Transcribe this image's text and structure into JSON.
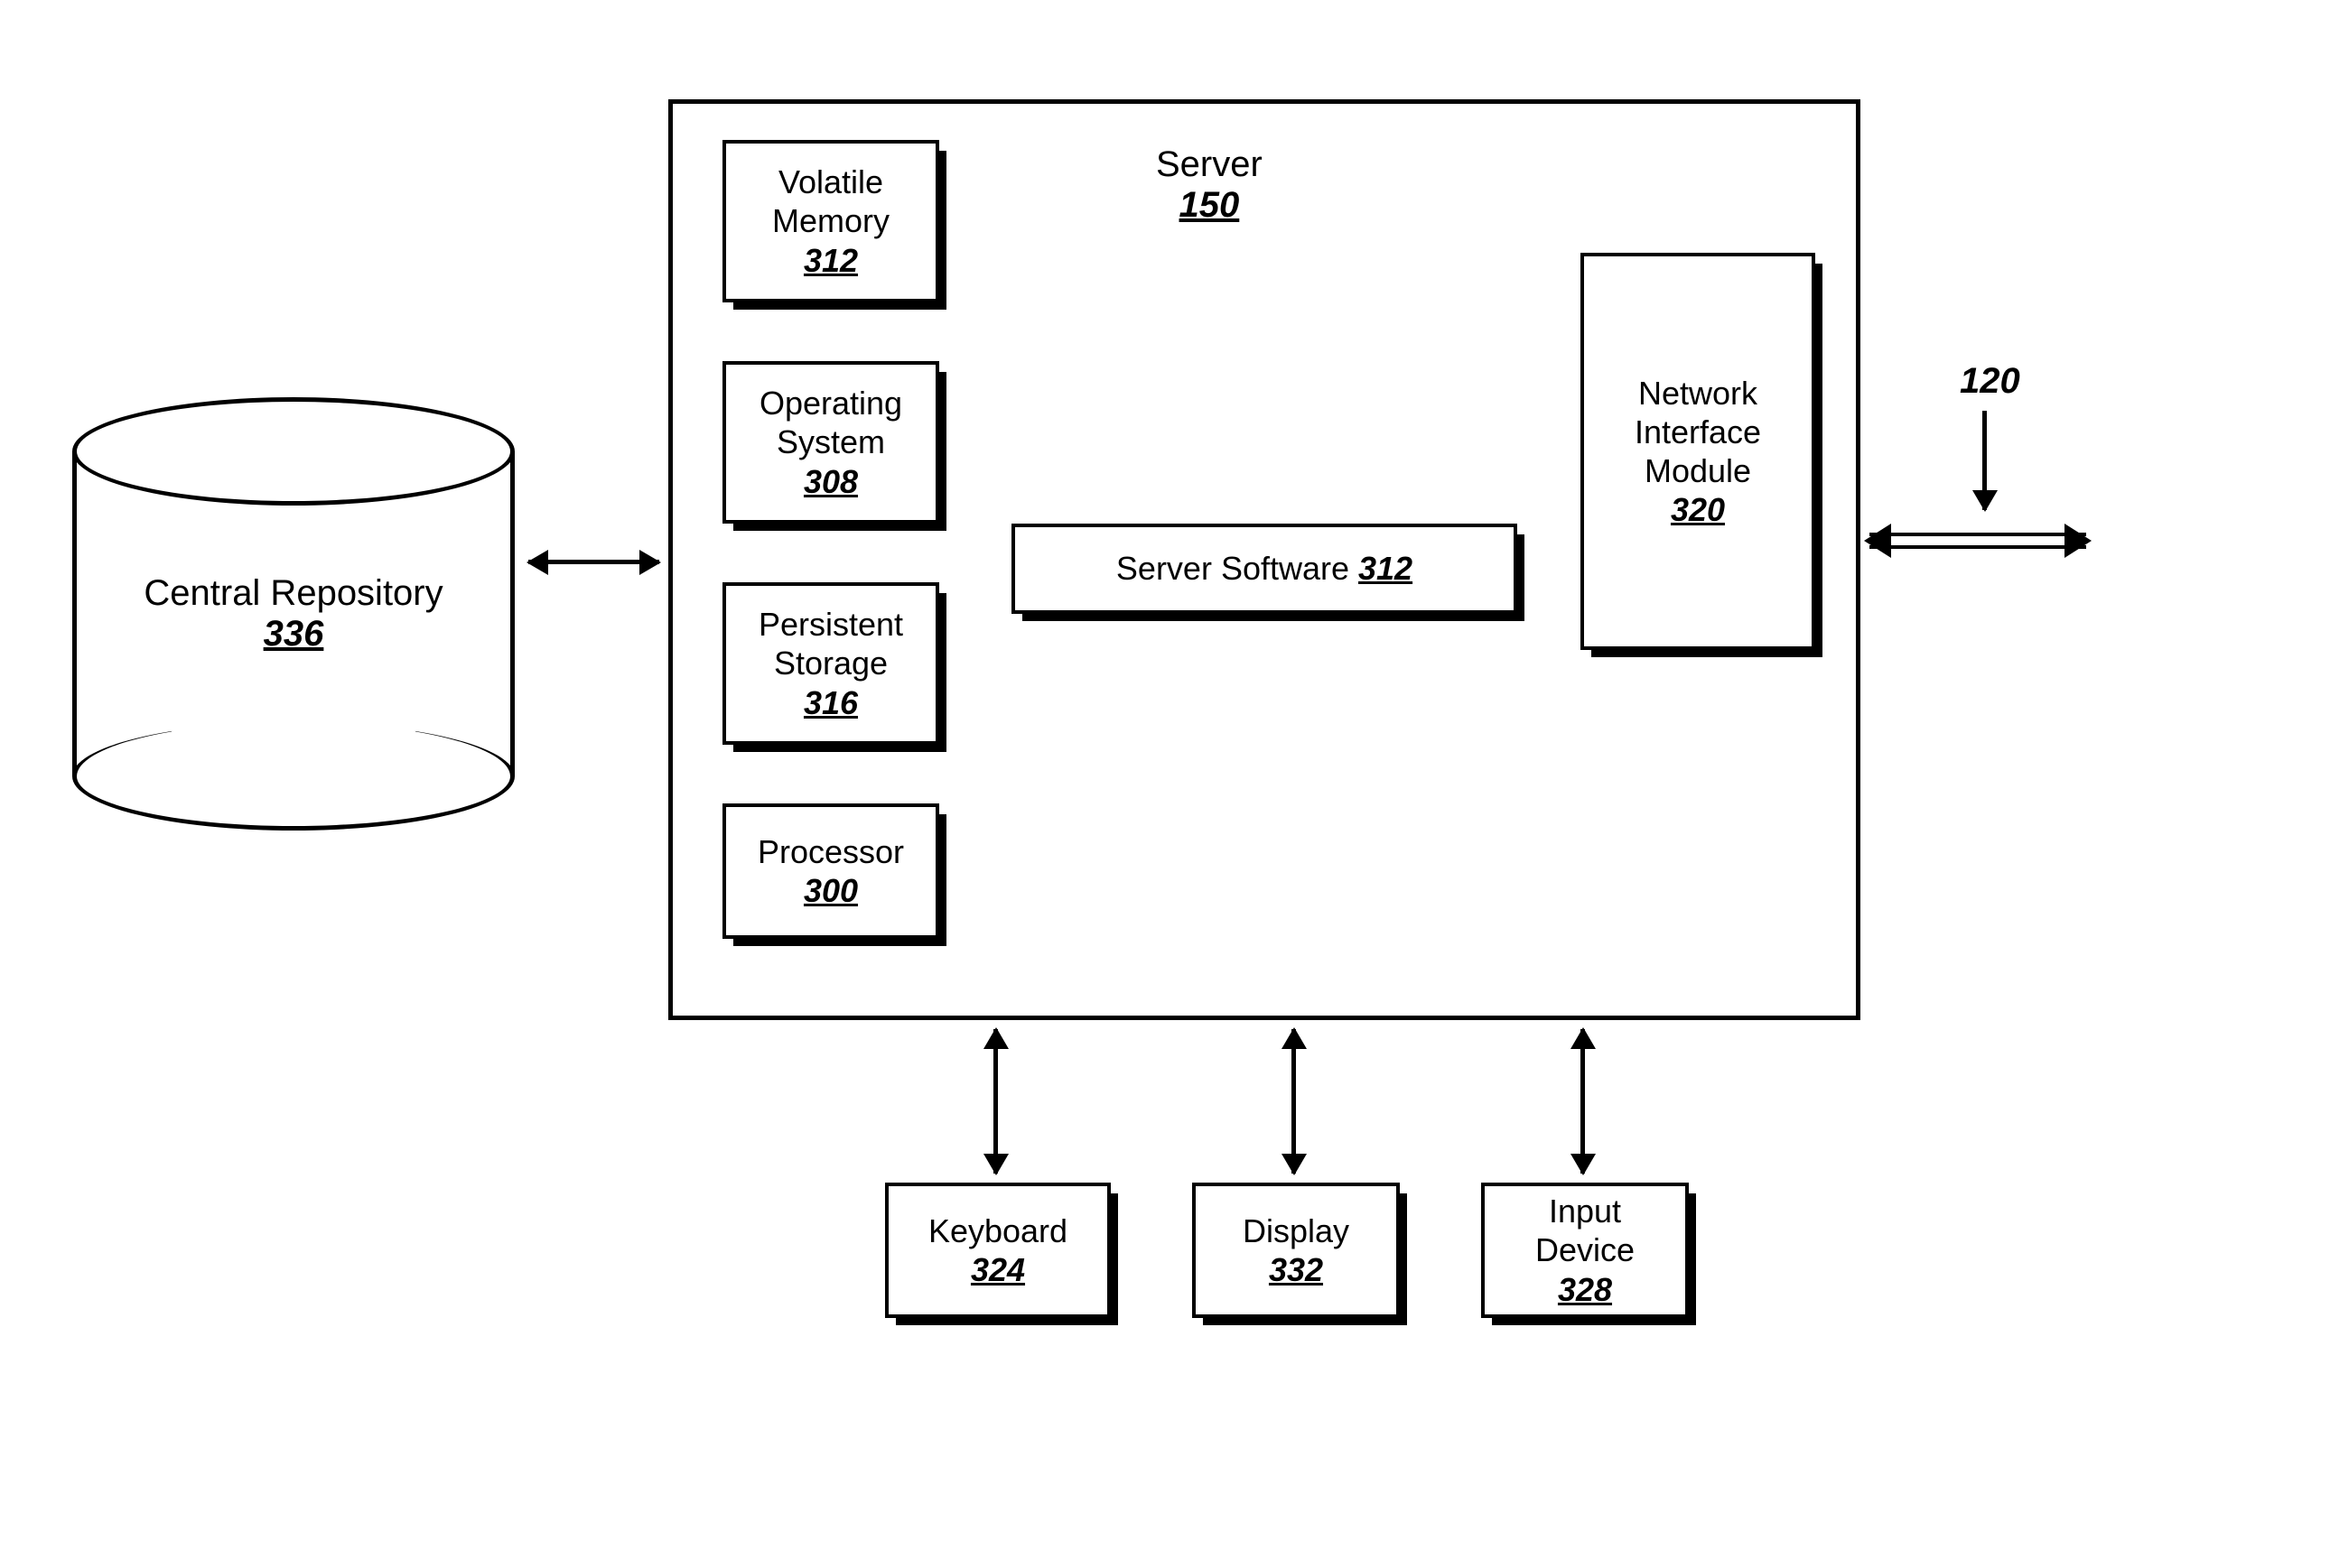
{
  "repository": {
    "label": "Central Repository",
    "ref": "336"
  },
  "server": {
    "label": "Server",
    "ref": "150"
  },
  "components": {
    "volatile_memory": {
      "label": "Volatile\nMemory",
      "ref": "312"
    },
    "operating_system": {
      "label": "Operating\nSystem",
      "ref": "308"
    },
    "persistent_storage": {
      "label": "Persistent\nStorage",
      "ref": "316"
    },
    "processor": {
      "label": "Processor",
      "ref": "300"
    },
    "server_software": {
      "label": "Server Software",
      "ref": "312"
    },
    "network_interface": {
      "label": "Network\nInterface\nModule",
      "ref": "320"
    }
  },
  "peripherals": {
    "keyboard": {
      "label": "Keyboard",
      "ref": "324"
    },
    "display": {
      "label": "Display",
      "ref": "332"
    },
    "input_device": {
      "label": "Input\nDevice",
      "ref": "328"
    }
  },
  "external_ref": "120"
}
